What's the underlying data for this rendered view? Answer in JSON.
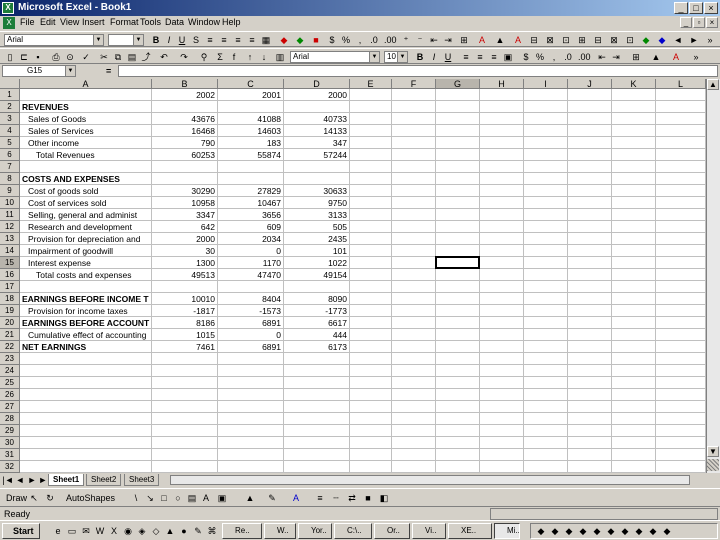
{
  "window": {
    "title": "Microsoft Excel - Book1"
  },
  "menu": [
    "File",
    "Edit",
    "View",
    "Insert",
    "Format",
    "Tools",
    "Data",
    "Window",
    "Help"
  ],
  "toolbar1": {
    "font": "Arial"
  },
  "toolbar2": {
    "font": "Arial",
    "size": "10"
  },
  "formula": {
    "namebox": "G15",
    "equals": "="
  },
  "columns": [
    "A",
    "B",
    "C",
    "D",
    "E",
    "F",
    "G",
    "H",
    "I",
    "J",
    "K",
    "L"
  ],
  "rows": [
    {
      "n": "1",
      "a": "",
      "b": "2002",
      "c": "2001",
      "d": "2000",
      "style": "hdr"
    },
    {
      "n": "2",
      "a": "REVENUES",
      "b": "",
      "c": "",
      "d": "",
      "style": "bold"
    },
    {
      "n": "3",
      "a": "Sales of Goods",
      "b": "43676",
      "c": "41088",
      "d": "40733",
      "style": "ind"
    },
    {
      "n": "4",
      "a": "Sales of Services",
      "b": "16468",
      "c": "14603",
      "d": "14133",
      "style": "ind"
    },
    {
      "n": "5",
      "a": "Other income",
      "b": "790",
      "c": "183",
      "d": "347",
      "style": "ind"
    },
    {
      "n": "6",
      "a": "Total Revenues",
      "b": "60253",
      "c": "55874",
      "d": "57244",
      "style": "ind2"
    },
    {
      "n": "7",
      "a": "",
      "b": "",
      "c": "",
      "d": "",
      "style": ""
    },
    {
      "n": "8",
      "a": "COSTS AND EXPENSES",
      "b": "",
      "c": "",
      "d": "",
      "style": "bold"
    },
    {
      "n": "9",
      "a": "Cost of goods sold",
      "b": "30290",
      "c": "27829",
      "d": "30633",
      "style": "ind"
    },
    {
      "n": "10",
      "a": "Cost of services sold",
      "b": "10958",
      "c": "10467",
      "d": "9750",
      "style": "ind"
    },
    {
      "n": "11",
      "a": "Selling, general and administ",
      "b": "3347",
      "c": "3656",
      "d": "3133",
      "style": "ind"
    },
    {
      "n": "12",
      "a": "Research and development",
      "b": "642",
      "c": "609",
      "d": "505",
      "style": "ind"
    },
    {
      "n": "13",
      "a": "Provision for depreciation and",
      "b": "2000",
      "c": "2034",
      "d": "2435",
      "style": "ind"
    },
    {
      "n": "14",
      "a": "Impairment of goodwill",
      "b": "30",
      "c": "0",
      "d": "101",
      "style": "ind"
    },
    {
      "n": "15",
      "a": "Interest expense",
      "b": "1300",
      "c": "1170",
      "d": "1022",
      "style": "ind"
    },
    {
      "n": "16",
      "a": "Total costs and expenses",
      "b": "49513",
      "c": "47470",
      "d": "49154",
      "style": "ind2"
    },
    {
      "n": "17",
      "a": "",
      "b": "",
      "c": "",
      "d": "",
      "style": ""
    },
    {
      "n": "18",
      "a": "EARNINGS BEFORE INCOME T",
      "b": "10010",
      "c": "8404",
      "d": "8090",
      "style": "bold"
    },
    {
      "n": "19",
      "a": "Provision for income taxes",
      "b": "-1817",
      "c": "-1573",
      "d": "-1773",
      "style": "ind"
    },
    {
      "n": "20",
      "a": "EARNINGS BEFORE ACCOUNT",
      "b": "8186",
      "c": "6891",
      "d": "6617",
      "style": "bold"
    },
    {
      "n": "21",
      "a": "Cumulative effect of accounting",
      "b": "1015",
      "c": "0",
      "d": "444",
      "style": "ind"
    },
    {
      "n": "22",
      "a": "NET EARNINGS",
      "b": "7461",
      "c": "6891",
      "d": "6173",
      "style": "bold"
    },
    {
      "n": "23",
      "a": "",
      "b": "",
      "c": "",
      "d": "",
      "style": ""
    },
    {
      "n": "24",
      "a": "",
      "b": "",
      "c": "",
      "d": "",
      "style": ""
    },
    {
      "n": "25",
      "a": "",
      "b": "",
      "c": "",
      "d": "",
      "style": ""
    },
    {
      "n": "26",
      "a": "",
      "b": "",
      "c": "",
      "d": "",
      "style": ""
    },
    {
      "n": "27",
      "a": "",
      "b": "",
      "c": "",
      "d": "",
      "style": ""
    },
    {
      "n": "28",
      "a": "",
      "b": "",
      "c": "",
      "d": "",
      "style": ""
    },
    {
      "n": "29",
      "a": "",
      "b": "",
      "c": "",
      "d": "",
      "style": ""
    },
    {
      "n": "30",
      "a": "",
      "b": "",
      "c": "",
      "d": "",
      "style": ""
    },
    {
      "n": "31",
      "a": "",
      "b": "",
      "c": "",
      "d": "",
      "style": ""
    },
    {
      "n": "32",
      "a": "",
      "b": "",
      "c": "",
      "d": "",
      "style": ""
    }
  ],
  "sheets": [
    "Sheet1",
    "Sheet2",
    "Sheet3"
  ],
  "draw": {
    "draw_label": "Draw",
    "autoshapes_label": "AutoShapes"
  },
  "status": {
    "text": "Ready"
  },
  "taskbar": {
    "start": "Start",
    "tasks": [
      "Re..",
      "W..",
      "Yor..",
      "C:\\..",
      "Or..",
      "Vi..",
      "XE..",
      "Mi.."
    ]
  },
  "colors": {
    "title_start": "#0a246a",
    "title_end": "#a6caf0",
    "face": "#d4d0c8"
  }
}
